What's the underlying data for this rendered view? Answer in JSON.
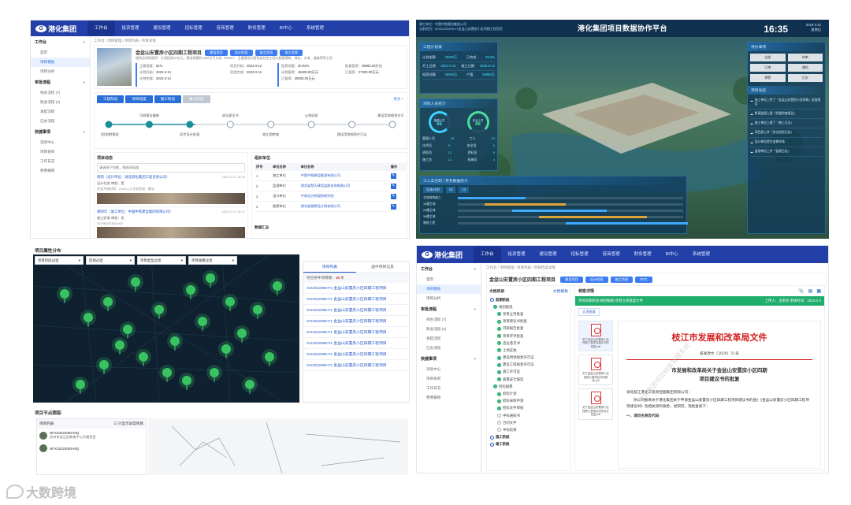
{
  "q1": {
    "logo": "港化集团",
    "nav": [
      "工作台",
      "投资管理",
      "建设管理",
      "招标管理",
      "容商管理",
      "财务管理",
      "BI中心",
      "系统管理"
    ],
    "side": [
      {
        "g": "工作台",
        "items": [
          "首页",
          "项目看板",
          "项目分析"
        ]
      },
      {
        "g": "审批流程",
        "items": [
          "待办流程 (7)",
          "知会流程 (3)",
          "发起流程",
          "已办流程"
        ]
      },
      {
        "g": "快捷事项",
        "items": [
          "消息中心",
          "项目协同",
          "工作日志",
          "费用报销"
        ]
      }
    ],
    "crumb": "工作台 / 项目管理 / 项目列表 / 项目详情",
    "project_title": "金盆山安置房小区四期工程项目",
    "tags": [
      "建设项目",
      "设计阶段",
      "施工阶段",
      "竣工验收"
    ],
    "desc": "规划总用地面积：计划投资45亿元，建设规模约1909万平方米（RMZF）  主要建设内容包括住宅工程与配套建筑、绿化、水电、道路等等工程",
    "progress": [
      {
        "k": "工期进度",
        "v": "61%"
      },
      {
        "k": "计划开始",
        "v": "2023-3-12"
      },
      {
        "k": "计划完成",
        "v": "2023-3-12"
      }
    ],
    "progress2": [
      {
        "k": "项目开始",
        "v": "2023-3-12"
      },
      {
        "k": "项目完成",
        "v": "2023-3-12"
      }
    ],
    "invest": [
      {
        "k": "投资进度",
        "v": "30.02%"
      },
      {
        "k": "计划投资",
        "v": "45000.00万元"
      },
      {
        "k": "已投资",
        "v": "39000.00万元"
      }
    ],
    "invest2": [
      {
        "k": "批复投资",
        "v": "49000.00万元"
      },
      {
        "k": "已投资",
        "v": "27000.00万元"
      }
    ],
    "tabs": [
      "工程阶段",
      "项目进度",
      "施工阶段",
      "竣工阶段"
    ],
    "more": "更多 >",
    "steps": [
      "项目前期报批",
      "可研报告编制",
      "初步设计批复",
      "选址意见书",
      "施工图审查",
      "土地征收",
      "建设用地规划许可证",
      "建设用地规划许可证"
    ],
    "dyn": {
      "title": "项目动态",
      "filter": "请选择下拉框，筛选项动态",
      "items": [
        {
          "who": "周雨（设计单位：湖北港化集团工程咨询公司）",
          "time": "2023-2-21 15:23",
          "t1": "设计任务",
          "t2": "审批：是",
          "t3": "任务开始时间：2023-2-2    任务完成：确认"
        },
        {
          "who": "胡明华（施工单位：中国中铁建设集团有限公司）",
          "time": "2023-2-21 15:21",
          "t1": "竣工验收",
          "t2": "审批：无",
          "t3": "GCHB202302-002"
        }
      ]
    },
    "org": {
      "title": "组织单位",
      "cols": [
        "序号",
        "单位名称",
        "单位名称",
        "操作"
      ],
      "rows": [
        [
          "1",
          "施工单位",
          "中国中铁建设集团有限公司"
        ],
        [
          "2",
          "监理单位",
          "湖北省楚天建设监理咨询有限公司"
        ],
        [
          "3",
          "设计单位",
          "中南设计院规划研究院"
        ],
        [
          "4",
          "勘察单位",
          "湖北省勘察设计院有限公司"
        ]
      ],
      "footer": "数据汇总"
    }
  },
  "q2": {
    "title": "港化集团项目数据协作平台",
    "clock": "16:35",
    "date": "2023-3-12",
    "weekday": "星期日",
    "sub1": "建工单位：中国中铁建设集团公司",
    "sub2": "当前项目：GH20220099-F1金盆山安置房小区四期工程项目",
    "left_cards": [
      {
        "t": "工程计划表"
      },
      {
        "t": "项目人员统计"
      },
      {
        "t": "工人实名制 / 劳务数据统计"
      }
    ],
    "stats": [
      [
        "计划金额",
        "45000万",
        "已完成",
        "29.3%"
      ],
      [
        "开工日期",
        "2023-3-12",
        "竣工日期",
        "2025-6-12"
      ],
      [
        "投资总额",
        "45000万",
        "产值",
        "34900万"
      ]
    ],
    "ring1": {
      "label": "管理人员",
      "v": "55"
    },
    "ring2": {
      "label": "作业人员",
      "v": "88"
    },
    "people": [
      [
        "管理人员",
        "16",
        "工人",
        "34"
      ],
      [
        "技术员",
        "8",
        "安全员",
        "9"
      ],
      [
        "质检员",
        "12",
        "资料员",
        "6"
      ],
      [
        "施工员",
        "14",
        "机械员",
        "4"
      ]
    ],
    "gantt_tab": [
      "总体计划",
      "13",
      "13"
    ],
    "rows": [
      "主体结构施工",
      "1#楼主体",
      "2#楼主体",
      "3#楼主体",
      "装修工程"
    ],
    "right_title": "待办事项",
    "todo_tabs": [
      "全部",
      "待审",
      "已审",
      "通知",
      "预警",
      "已办"
    ],
    "right2": "项目动态",
    "notices": [
      "施工单位上传了『金盆山安置房小区四期』进度报告",
      "陈雨监理上报『质量检查报告』",
      "施工单位上报了『施工日志』",
      "项目部上传『安全巡检记录』",
      "设计单位提交变更申请",
      "监理单位上传『监理日志』"
    ]
  },
  "q3": {
    "title": "项目属性分布",
    "filters": [
      "项目阶段过滤",
      "区域过滤",
      "项目类型过滤",
      "项目规模过滤"
    ],
    "tabs": [
      "项目列表",
      "选中项目信息"
    ],
    "count_label": "符合条件项目数：",
    "count": "16",
    "count_unit": "条",
    "list": [
      "GH2022098-F1 金盆山安置房小区四期工程项目",
      "GH2022098-F1 金盆山安置房小区四期工程项目",
      "GH2022098-F1 金盆山安置房小区四期工程项目",
      "GH2022098-F1 金盆山安置房小区四期工程项目",
      "GH2022098-F1 金盆山安置房小区四期工程项目",
      "GH2022098-F1 金盆山安置房小区四期工程项目",
      "GH2022098-F1 金盆山安置房小区四期工程项目",
      "GH2022098-F1 金盆山安置房小区四期工程项目"
    ],
    "node_title": "项目节点跟踪",
    "node_list": "项目列表",
    "node_check": "只显示异常项目",
    "node_items": [
      {
        "id": "NFXS2023059-MQ",
        "name": "苏州市吴江区新街中心大楼项目"
      },
      {
        "id": "NFXS2023059-MQ",
        "name": ""
      }
    ]
  },
  "q4": {
    "logo": "港化集团",
    "nav": [
      "工作台",
      "投资管理",
      "建设管理",
      "招标管理",
      "容商管理",
      "财务管理",
      "BI中心",
      "系统管理"
    ],
    "side": [
      {
        "g": "工作台",
        "items": [
          "首页",
          "项目看板",
          "项目分析"
        ]
      },
      {
        "g": "审批流程",
        "items": [
          "待办流程 (7)",
          "知会流程 (4)",
          "发起流程",
          "已办流程"
        ]
      },
      {
        "g": "快捷事项",
        "items": [
          "消息中心",
          "项目协同",
          "工作日志",
          "费用报销"
        ]
      }
    ],
    "crumb": "工作台 / 项目管理 / 项目列表 / 项目档案详情",
    "title": "金盆山安置房小区四期工程项目",
    "tags": [
      "建设项目",
      "设计阶段",
      "施工阶段",
      "DOC"
    ],
    "tree_title": "文档目录",
    "tree_link": "文档模板",
    "tree": [
      {
        "g": "前期阶段",
        "sub": "规划报批",
        "items": [
          "项目立项批复",
          "项目建议书批复",
          "可研报告批复",
          "项目环评批复",
          "选址意见书",
          "土地征收",
          "建设用地规划许可证",
          "建设工程规划许可证",
          "施工许可证",
          "质量安全报监"
        ]
      },
      {
        "g": "",
        "sub": "招标报建",
        "items": [
          "招标计划",
          "招标采购申请",
          "招标文件审核",
          "中标通知书",
          "合同文件",
          "中标结果"
        ]
      },
      {
        "g": "施工阶段"
      },
      {
        "g": "竣工阶段"
      }
    ],
    "doc_head": "档案详情",
    "doc_bar": "项目前期阶段-规划报批-项目立项批复文件",
    "uploader_k": "上传人：",
    "uploader_v": "王彤彤",
    "date_k": "审核时间：",
    "date_v": "2023-2-3",
    "sub_tag": "立项批复",
    "files": [
      "关于金盆山安置房小区四期工程项目建议书的批复.pdf",
      "关于金盆山安置房小区四期工程项目可研报告.pdf",
      "关于金盆山安置房小区四期工程项目初步设计批复.pdf"
    ],
    "doc_title": "枝江市发展和改革局文件",
    "doc_no": "枝发改文〔2020〕51号",
    "doc_sub1": "市发展和改革局关于金盆山安置房小区四期",
    "doc_sub2": "项目建议书的批复",
    "doc_body1": "湖北枝江港化工投资控股集团有限公司：",
    "doc_body2": "你公司报来关于港化集团关于申请金盆山安置房小区四期工程项目建议书的函》《金盆山安置房小区四期工程项目建议书》及相关资料收悉，经研究，现批复如下：",
    "doc_body3": "一、项目名称及代码",
    "watermark": "港化集团项目档案管理系统"
  },
  "footer": {
    "brand": "大数跨境"
  }
}
